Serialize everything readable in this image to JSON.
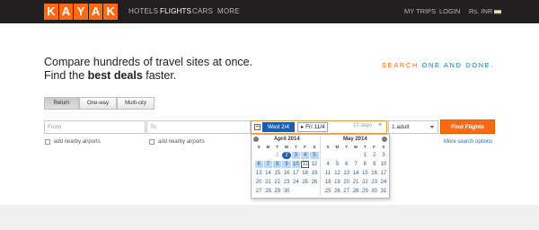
{
  "logo": {
    "letters": [
      "K",
      "A",
      "Y",
      "A",
      "K"
    ],
    "brand_color": "#ff690f"
  },
  "nav": {
    "hotels": "HOTELS",
    "flights": "FLIGHTS",
    "cars": "CARS",
    "more": "MORE",
    "my_trips": "MY TRIPS",
    "login": "LOGIN",
    "currency": "Rs. INR"
  },
  "hero": {
    "line1": "Compare hundreds of travel sites at once.",
    "line2_pre": "Find the ",
    "line2_bold": "best deals",
    "line2_post": " faster."
  },
  "slogan": {
    "search": "SEARCH",
    "one_and_done": "ONE AND DONE."
  },
  "trip_tabs": {
    "return": "Return",
    "one_way": "One-way",
    "multi_city": "Multi-city",
    "selected": "Return"
  },
  "search": {
    "from_placeholder": "From",
    "to_placeholder": "To",
    "nearby_from": "add nearby airports",
    "nearby_to": "add nearby airports",
    "depart": "Wed 2/4",
    "return": "Fri 11/4",
    "duration": "10 days",
    "clear": "×",
    "travelers": "1 adult",
    "find_button": "Find Flights",
    "more_options": "More search options"
  },
  "calendar": {
    "weekdays": [
      "S",
      "M",
      "T",
      "W",
      "T",
      "F",
      "S"
    ],
    "left": {
      "title": "April  2014",
      "cells": [
        {
          "d": "",
          "s": ""
        },
        {
          "d": "",
          "s": ""
        },
        {
          "d": "1",
          "s": "past"
        },
        {
          "d": "2",
          "s": "dep"
        },
        {
          "d": "3",
          "s": "range"
        },
        {
          "d": "4",
          "s": "range"
        },
        {
          "d": "5",
          "s": "range"
        },
        {
          "d": "6",
          "s": "range"
        },
        {
          "d": "7",
          "s": "range"
        },
        {
          "d": "8",
          "s": "range"
        },
        {
          "d": "9",
          "s": "range"
        },
        {
          "d": "10",
          "s": "range"
        },
        {
          "d": "11",
          "s": "ret"
        },
        {
          "d": "12",
          "s": ""
        },
        {
          "d": "13",
          "s": ""
        },
        {
          "d": "14",
          "s": ""
        },
        {
          "d": "15",
          "s": ""
        },
        {
          "d": "16",
          "s": ""
        },
        {
          "d": "17",
          "s": ""
        },
        {
          "d": "18",
          "s": ""
        },
        {
          "d": "19",
          "s": ""
        },
        {
          "d": "20",
          "s": ""
        },
        {
          "d": "21",
          "s": ""
        },
        {
          "d": "22",
          "s": ""
        },
        {
          "d": "23",
          "s": ""
        },
        {
          "d": "24",
          "s": ""
        },
        {
          "d": "25",
          "s": ""
        },
        {
          "d": "26",
          "s": ""
        },
        {
          "d": "27",
          "s": ""
        },
        {
          "d": "28",
          "s": ""
        },
        {
          "d": "29",
          "s": ""
        },
        {
          "d": "30",
          "s": ""
        }
      ]
    },
    "right": {
      "title": "May  2014",
      "cells": [
        {
          "d": "",
          "s": ""
        },
        {
          "d": "",
          "s": ""
        },
        {
          "d": "",
          "s": ""
        },
        {
          "d": "",
          "s": ""
        },
        {
          "d": "1",
          "s": ""
        },
        {
          "d": "2",
          "s": ""
        },
        {
          "d": "3",
          "s": ""
        },
        {
          "d": "4",
          "s": ""
        },
        {
          "d": "5",
          "s": ""
        },
        {
          "d": "6",
          "s": ""
        },
        {
          "d": "7",
          "s": ""
        },
        {
          "d": "8",
          "s": ""
        },
        {
          "d": "9",
          "s": ""
        },
        {
          "d": "10",
          "s": ""
        },
        {
          "d": "11",
          "s": ""
        },
        {
          "d": "12",
          "s": ""
        },
        {
          "d": "13",
          "s": ""
        },
        {
          "d": "14",
          "s": ""
        },
        {
          "d": "15",
          "s": ""
        },
        {
          "d": "16",
          "s": ""
        },
        {
          "d": "17",
          "s": ""
        },
        {
          "d": "18",
          "s": ""
        },
        {
          "d": "19",
          "s": ""
        },
        {
          "d": "20",
          "s": ""
        },
        {
          "d": "21",
          "s": ""
        },
        {
          "d": "22",
          "s": ""
        },
        {
          "d": "23",
          "s": ""
        },
        {
          "d": "24",
          "s": ""
        },
        {
          "d": "25",
          "s": ""
        },
        {
          "d": "26",
          "s": ""
        },
        {
          "d": "27",
          "s": ""
        },
        {
          "d": "28",
          "s": ""
        },
        {
          "d": "29",
          "s": ""
        },
        {
          "d": "30",
          "s": ""
        },
        {
          "d": "31",
          "s": ""
        }
      ]
    }
  }
}
